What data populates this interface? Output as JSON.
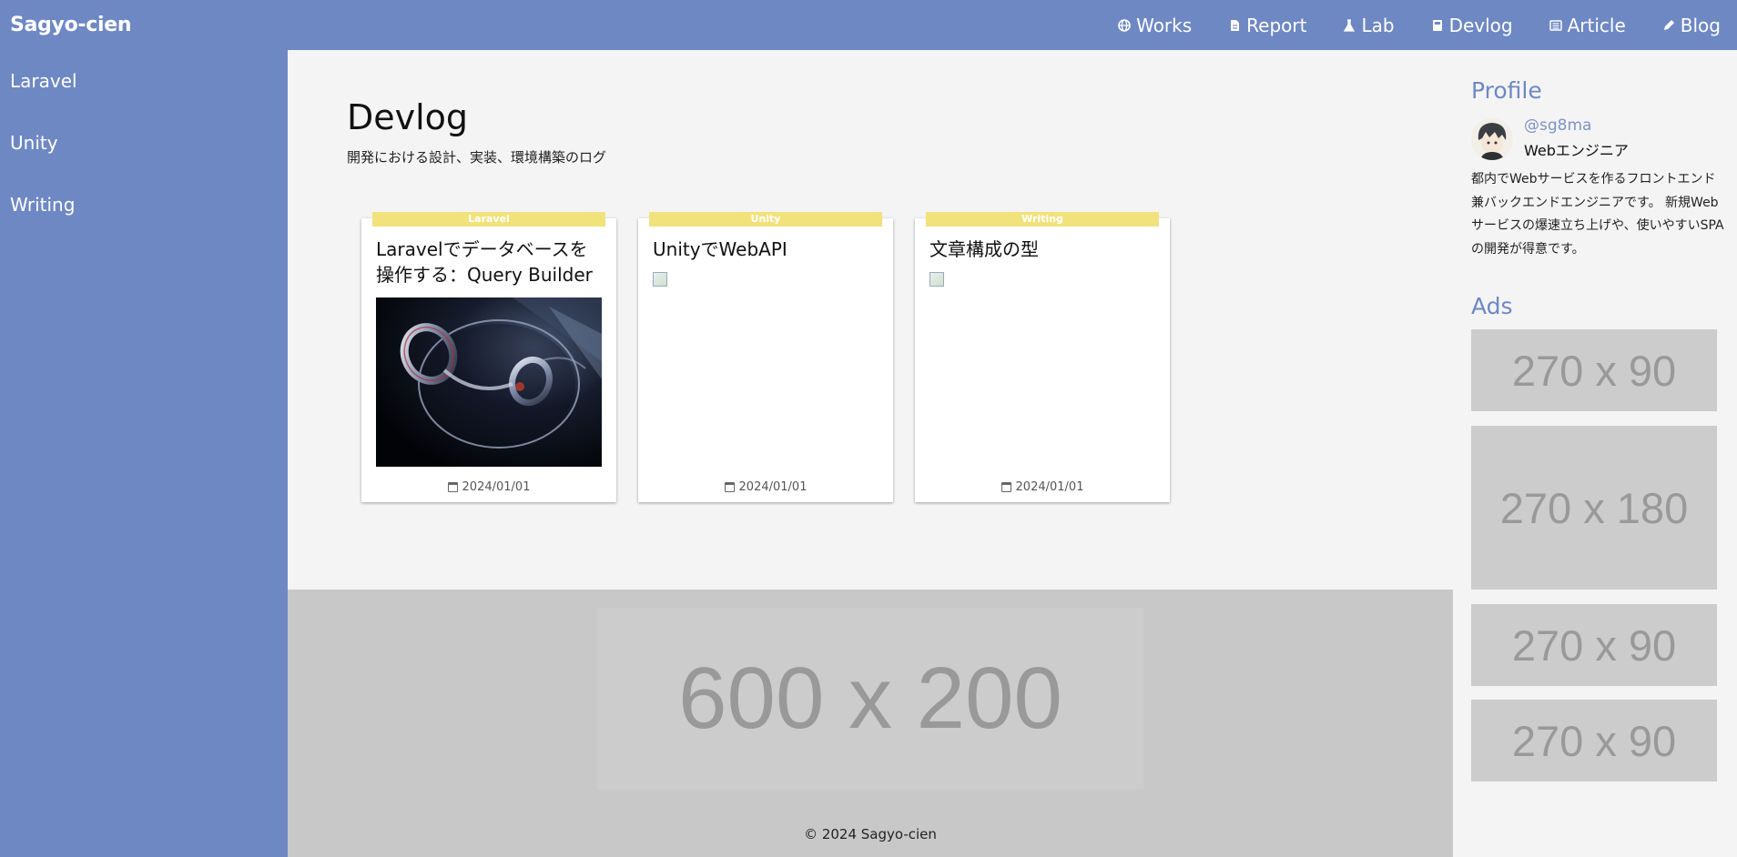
{
  "brand": "Sagyo-cien",
  "colors": {
    "nav_bg": "#6e88c4",
    "tag_bg": "#f1e27c",
    "accent_text": "#6e88c4",
    "ad_placeholder": "#cccccc"
  },
  "nav": {
    "items": [
      {
        "label": "Works",
        "icon": "globe-icon"
      },
      {
        "label": "Report",
        "icon": "document-icon"
      },
      {
        "label": "Lab",
        "icon": "flask-icon"
      },
      {
        "label": "Devlog",
        "icon": "notebook-icon"
      },
      {
        "label": "Article",
        "icon": "newspaper-icon"
      },
      {
        "label": "Blog",
        "icon": "pen-icon"
      }
    ]
  },
  "sidebar": {
    "items": [
      {
        "label": "Laravel"
      },
      {
        "label": "Unity"
      },
      {
        "label": "Writing"
      }
    ]
  },
  "main": {
    "title": "Devlog",
    "subtitle": "開発における設計、実装、環境構築のログ",
    "cards": [
      {
        "tag": "Laravel",
        "title": "Laravelでデータベースを操作する：Query Builder",
        "date": "2024/01/01",
        "has_image": true
      },
      {
        "tag": "Unity",
        "title": "UnityでWebAPI",
        "date": "2024/01/01",
        "has_image": false
      },
      {
        "tag": "Writing",
        "title": "文章構成の型",
        "date": "2024/01/01",
        "has_image": false
      }
    ]
  },
  "footer": {
    "ad_label": "600 x 200",
    "copyright": "© 2024 Sagyo-cien"
  },
  "right": {
    "profile_heading": "Profile",
    "handle": "@sg8ma",
    "role": "Webエンジニア",
    "bio": "都内でWebサービスを作るフロントエンド兼バックエンドエンジニアです。 新規Webサービスの爆速立ち上げや、使いやすいSPAの開発が得意です。",
    "ads_heading": "Ads",
    "ads": [
      "270 x 90",
      "270 x 180",
      "270 x 90",
      "270 x 90"
    ]
  }
}
